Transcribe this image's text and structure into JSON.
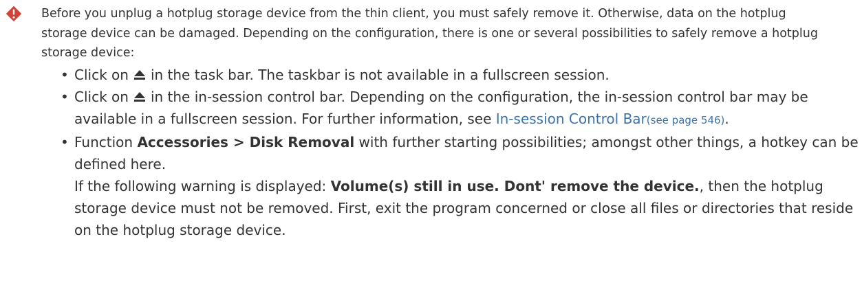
{
  "note": {
    "icon": "warning-diamond-icon",
    "icon_color": "#d04437",
    "intro": "Before you unplug a hotplug storage device from the thin client, you must safely remove it. Otherwise, data on the hotplug storage device can be damaged. Depending on the configuration, there is one or several possibilities to safely remove a hotplug storage device:"
  },
  "options": [
    {
      "prefix": "Click on",
      "icon": "eject-icon",
      "suffix": "in the task bar. The taskbar is not available in a fullscreen session."
    },
    {
      "prefix": "Click on",
      "icon": "eject-icon",
      "suffix": "in the in-session control bar. Depending on the configuration, the in-session control bar may be available in a fullscreen session. For further information, see ",
      "link": "In-session Control Bar",
      "page_ref": "(see page 546)",
      "end": "."
    },
    {
      "prefix": "Function ",
      "bold": "Accessories > Disk Removal",
      "suffix": " with further starting possibilities; amongst other things, a hotkey can be defined here.",
      "warning_prefix": "If the following warning is displayed: ",
      "warning_bold": "Volume(s) still in use. Dont' remove the device.",
      "warning_suffix": ", then the hotplug storage device must not be removed. First, exit the program concerned or close all files or directories that reside on the hotplug storage device."
    }
  ],
  "colors": {
    "text": "#333333",
    "link": "#3b73af",
    "warning": "#d04437"
  }
}
